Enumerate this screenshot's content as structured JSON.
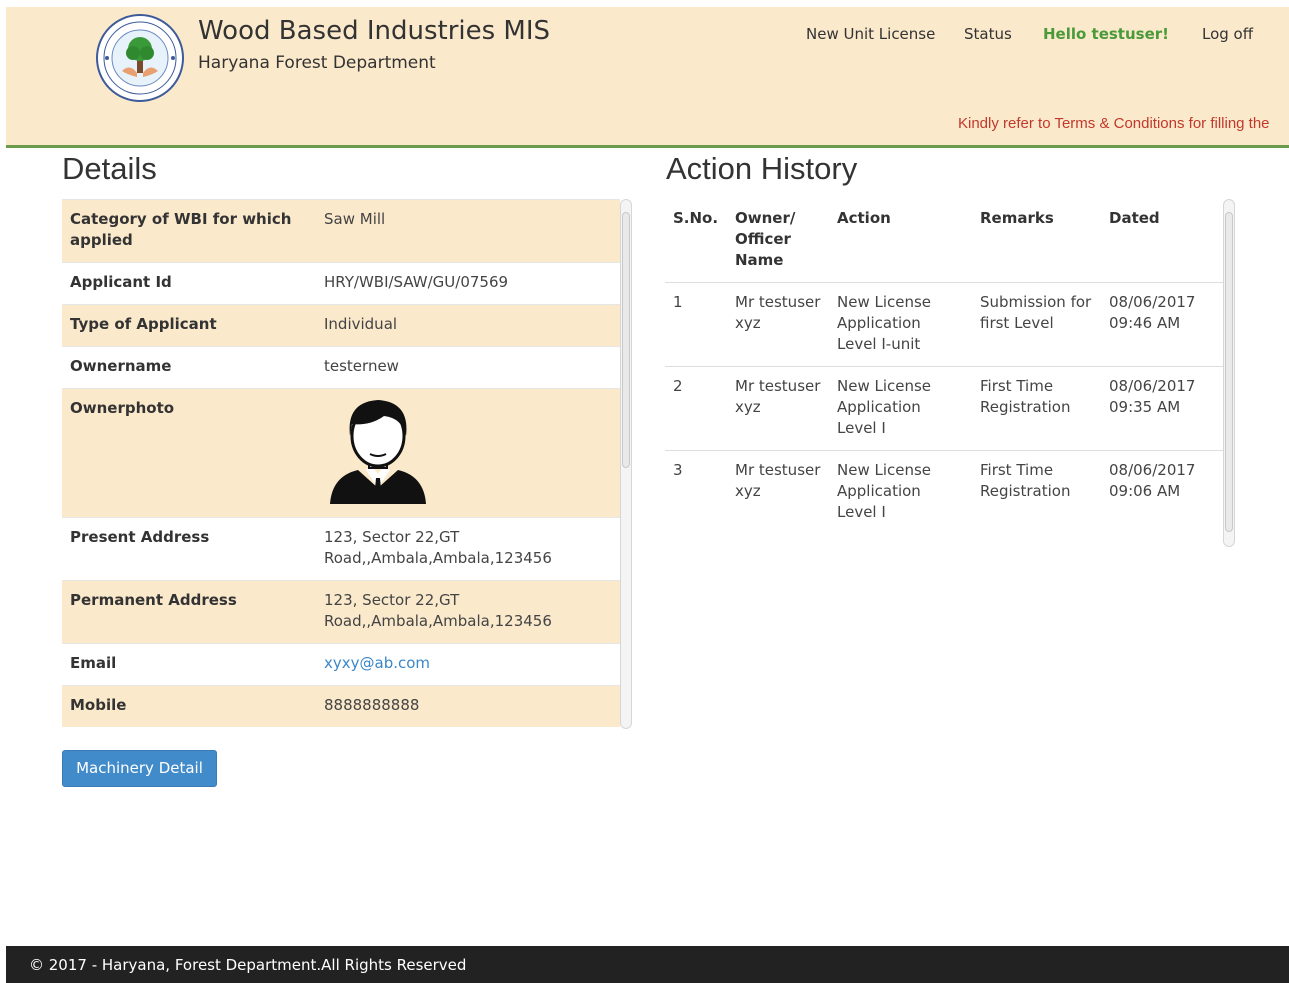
{
  "header": {
    "title": "Wood Based Industries MIS",
    "subtitle": "Haryana Forest Department",
    "nav": {
      "new_unit_license": "New Unit License",
      "status": "Status",
      "hello": "Hello testuser!",
      "log_off": "Log off"
    },
    "notice": "Kindly refer to Terms & Conditions for filling the"
  },
  "details": {
    "title": "Details",
    "rows": [
      {
        "label": "Category of WBI for which applied",
        "value": "Saw Mill"
      },
      {
        "label": "Applicant Id",
        "value": "HRY/WBI/SAW/GU/07569"
      },
      {
        "label": "Type of Applicant",
        "value": "Individual"
      },
      {
        "label": "Ownername",
        "value": "testernew"
      },
      {
        "label": "Ownerphoto",
        "value": ""
      },
      {
        "label": "Present Address",
        "value": "123, Sector 22,GT Road,,Ambala,Ambala,123456"
      },
      {
        "label": "Permanent Address",
        "value": "123, Sector 22,GT Road,,Ambala,Ambala,123456"
      },
      {
        "label": "Email",
        "value": "xyxy@ab.com"
      },
      {
        "label": "Mobile",
        "value": "8888888888"
      }
    ],
    "button": "Machinery Detail"
  },
  "history": {
    "title": "Action History",
    "columns": [
      "S.No.",
      "Owner/ Officer Name",
      "Action",
      "Remarks",
      "Dated"
    ],
    "rows": [
      {
        "sno": "1",
        "owner": "Mr testuser xyz",
        "action": "New License Application Level I-unit",
        "remarks": "Submission for first Level",
        "dated": "08/06/2017 09:46 AM"
      },
      {
        "sno": "2",
        "owner": "Mr testuser xyz",
        "action": "New License Application Level I",
        "remarks": "First Time Registration",
        "dated": "08/06/2017 09:35 AM"
      },
      {
        "sno": "3",
        "owner": "Mr testuser xyz",
        "action": "New License Application Level I",
        "remarks": "First Time Registration",
        "dated": "08/06/2017 09:06 AM"
      }
    ]
  },
  "footer": {
    "text": "© 2017 - Haryana, Forest Department.All Rights Reserved"
  }
}
